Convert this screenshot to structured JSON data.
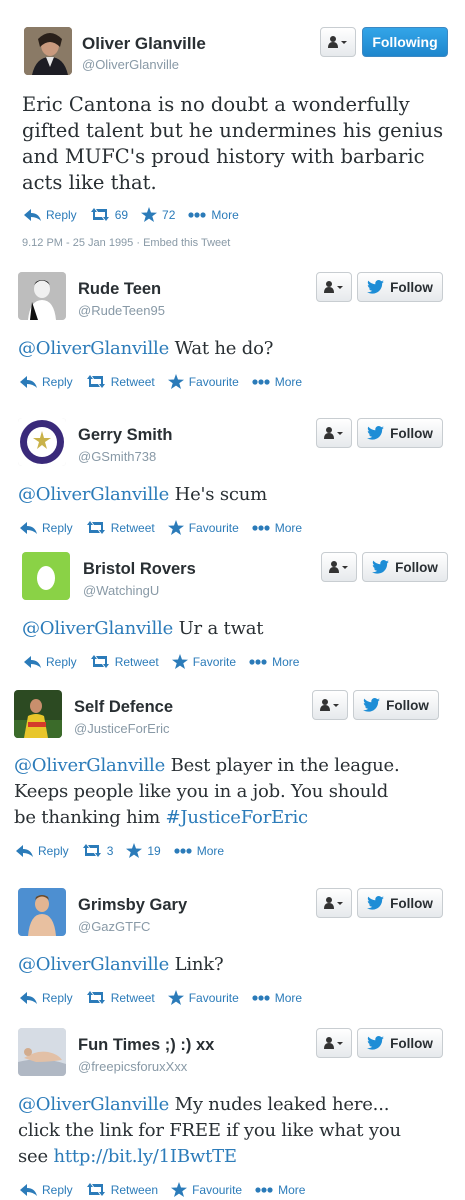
{
  "main_tweet": {
    "name": "Oliver Glanville",
    "handle": "@OliverGlanville",
    "following_label": "Following",
    "text_lines": [
      "Eric Cantona is no doubt a wonderfully",
      "gifted talent but he undermines his genius",
      "and MUFC's proud history with barbaric",
      "acts like that."
    ],
    "actions": {
      "reply": "Reply",
      "retweets": "69",
      "favourites": "72",
      "more": "More"
    },
    "timestamp": "9.12 PM - 25 Jan 1995",
    "separator": "·",
    "embed": "Embed this Tweet"
  },
  "replies": [
    {
      "name": "Rude Teen",
      "handle": "@RudeTeen95",
      "follow_label": "Follow",
      "mention": "@OliverGlanville",
      "text_lines": [
        " Wat he do?"
      ],
      "hashtag": "",
      "link": "",
      "actions": {
        "reply": "Reply",
        "retweet": "Retweet",
        "favourite": "Favourite",
        "more": "More"
      }
    },
    {
      "name": "Gerry Smith",
      "handle": "@GSmith738",
      "follow_label": "Follow",
      "mention": "@OliverGlanville",
      "text_lines": [
        " He's scum"
      ],
      "hashtag": "",
      "link": "",
      "actions": {
        "reply": "Reply",
        "retweet": "Retweet",
        "favourite": "Favourite",
        "more": "More"
      }
    },
    {
      "name": "Bristol Rovers",
      "handle": "@WatchingU",
      "follow_label": "Follow",
      "mention": "@OliverGlanville",
      "text_lines": [
        " Ur a twat"
      ],
      "hashtag": "",
      "link": "",
      "actions": {
        "reply": "Reply",
        "retweet": "Retweet",
        "favourite": "Favorite",
        "more": "More"
      }
    },
    {
      "name": "Self Defence",
      "handle": "@JusticeForEric",
      "follow_label": "Follow",
      "mention": "@OliverGlanville",
      "text_lines": [
        " Best player in the league.",
        "Keeps people like you in a job. You should",
        "be thanking him "
      ],
      "hashtag": "#JusticeForEric",
      "link": "",
      "actions": {
        "reply": "Reply",
        "retweets": "3",
        "favourites": "19",
        "more": "More"
      }
    },
    {
      "name": "Grimsby Gary",
      "handle": "@GazGTFC",
      "follow_label": "Follow",
      "mention": "@OliverGlanville",
      "text_lines": [
        " Link?"
      ],
      "hashtag": "",
      "link": "",
      "actions": {
        "reply": "Reply",
        "retweet": "Retweet",
        "favourite": "Favourite",
        "more": "More"
      }
    },
    {
      "name": "Fun Times ;) :) xx",
      "handle": "@freepicsforuxXxx",
      "follow_label": "Follow",
      "mention": "@OliverGlanville",
      "text_lines": [
        " My nudes leaked here...",
        "click the link for FREE if you like what you",
        "see "
      ],
      "hashtag": "",
      "link": "http://bit.ly/1IBwtTE",
      "actions": {
        "reply": "Reply",
        "retweet": "Retween",
        "favourite": "Favourite",
        "more": "More"
      }
    }
  ],
  "colors": {
    "link": "#2b7bb9",
    "muted": "#8899a6",
    "follow_blue": "#1d8dd6",
    "text": "#292f33"
  }
}
